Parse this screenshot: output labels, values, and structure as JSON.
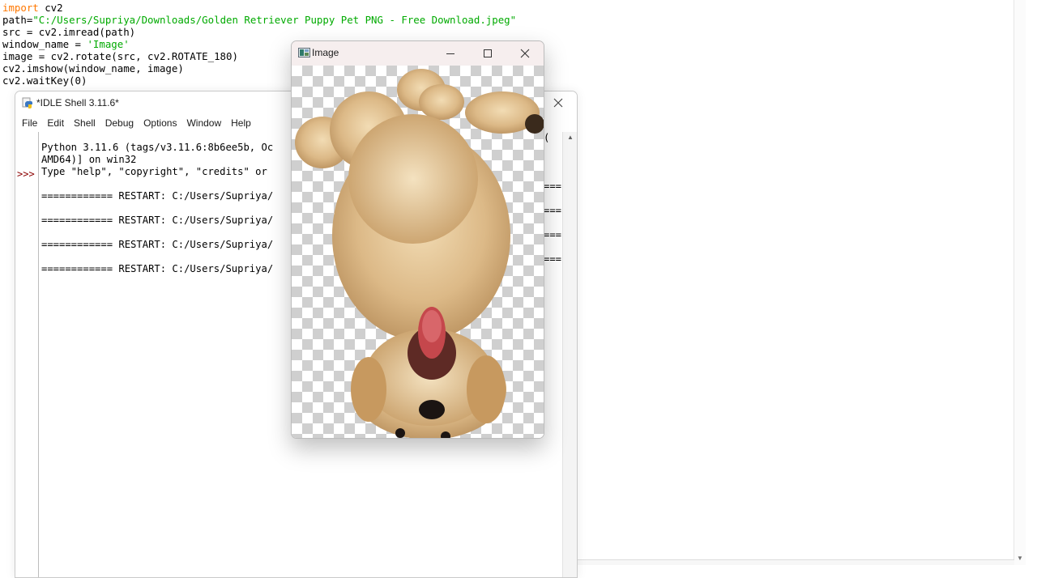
{
  "editor": {
    "code_lines": [
      {
        "parts": [
          {
            "t": "import",
            "c": "kw"
          },
          {
            "t": " cv2",
            "c": ""
          }
        ]
      },
      {
        "parts": [
          {
            "t": "path=",
            "c": ""
          },
          {
            "t": "\"C:/Users/Supriya/Downloads/Golden Retriever Puppy Pet PNG - Free Download.jpeg\"",
            "c": "str"
          }
        ]
      },
      {
        "parts": [
          {
            "t": "src = cv2.imread(path)",
            "c": ""
          }
        ]
      },
      {
        "parts": [
          {
            "t": "window_name = ",
            "c": ""
          },
          {
            "t": "'Image'",
            "c": "str"
          }
        ]
      },
      {
        "parts": [
          {
            "t": "image = cv2.rotate(src, cv2.ROTATE_180)",
            "c": ""
          }
        ]
      },
      {
        "parts": [
          {
            "t": "cv2.imshow(window_name, image)",
            "c": ""
          }
        ]
      },
      {
        "parts": [
          {
            "t": "cv2.waitKey(0)",
            "c": ""
          }
        ]
      }
    ]
  },
  "shell": {
    "title": "*IDLE Shell 3.11.6*",
    "menu": [
      "File",
      "Edit",
      "Shell",
      "Debug",
      "Options",
      "Window",
      "Help"
    ],
    "prompt": ">>>",
    "lines": [
      "Python 3.11.6 (tags/v3.11.6:8b6ee5b, Oc",
      "AMD64)] on win32",
      "Type \"help\", \"copyright\", \"credits\" or",
      "",
      "============ RESTART: C:/Users/Supriya/",
      "",
      "============ RESTART: C:/Users/Supriya/",
      "",
      "============ RESTART: C:/Users/Supriya/",
      "",
      "============ RESTART: C:/Users/Supriya/"
    ],
    "line_tails": [
      "(",
      "",
      "",
      "",
      "===",
      "",
      "===",
      "",
      "===",
      "",
      "==="
    ]
  },
  "image_window": {
    "title": "Image",
    "image_subject": "golden retriever puppy rotated 180 degrees on transparent checkerboard background"
  },
  "icons": {
    "shell_app": "python-idle-icon",
    "image_app": "opencv-window-icon",
    "minimize": "minimize-icon",
    "maximize": "maximize-icon",
    "close": "close-icon"
  }
}
